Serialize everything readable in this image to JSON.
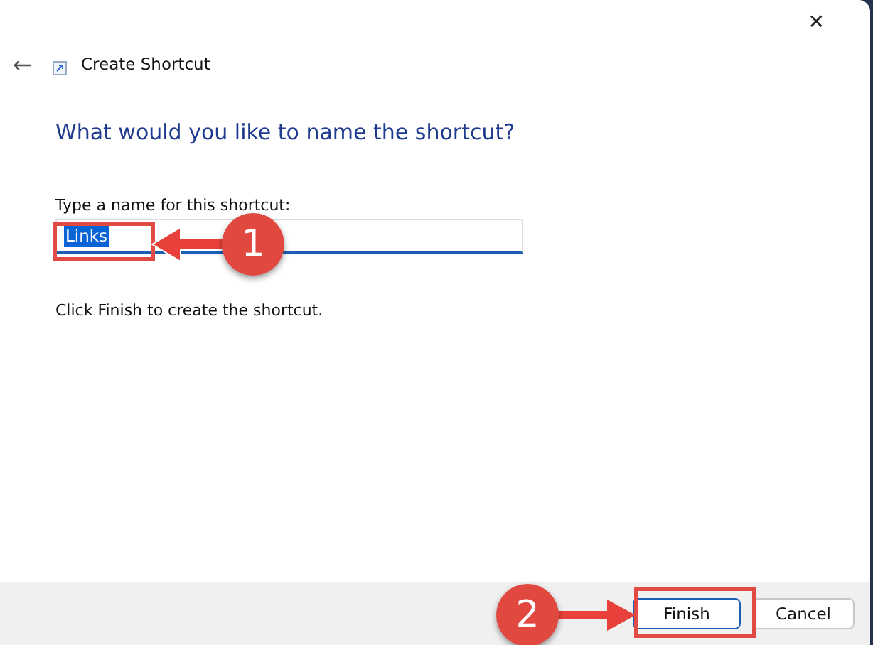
{
  "window": {
    "title": "Create Shortcut",
    "close": "✕",
    "back": "←"
  },
  "heading": "What would you like to name the shortcut?",
  "name_field": {
    "label": "Type a name for this shortcut:",
    "value": "Links",
    "selected": true
  },
  "instruction": "Click Finish to create the shortcut.",
  "buttons": [
    {
      "label": "Finish",
      "default": true
    },
    {
      "label": "Cancel",
      "default": false
    }
  ],
  "annotations": [
    {
      "number": "1"
    },
    {
      "number": "2"
    }
  ]
}
